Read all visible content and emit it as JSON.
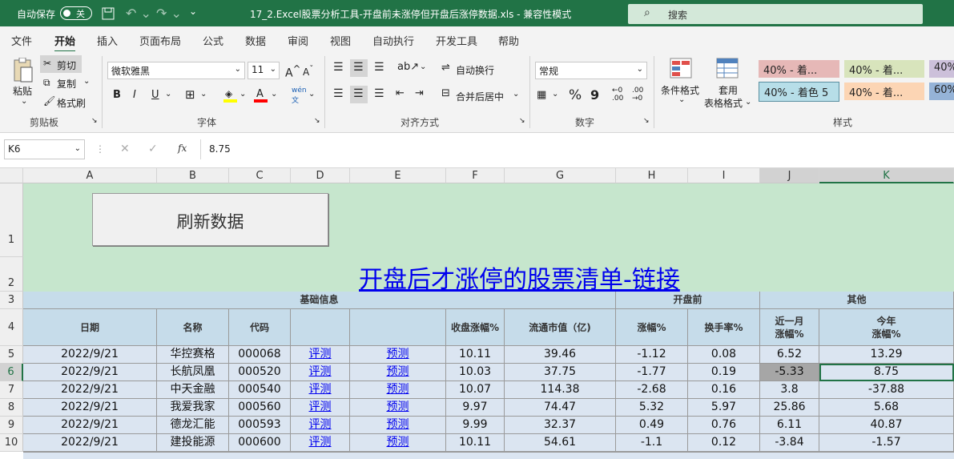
{
  "titlebar": {
    "autosave_label": "自动保存",
    "autosave_state": "关",
    "title": "17_2.Excel股票分析工具-开盘前未涨停但开盘后涨停数据.xls  -  兼容性模式",
    "search_placeholder": "搜索"
  },
  "tabs": [
    "文件",
    "开始",
    "插入",
    "页面布局",
    "公式",
    "数据",
    "审阅",
    "视图",
    "自动执行",
    "开发工具",
    "帮助"
  ],
  "ribbon": {
    "clipboard": {
      "paste": "粘贴",
      "cut": "剪切",
      "copy": "复制",
      "format_painter": "格式刷",
      "group": "剪贴板"
    },
    "font": {
      "name": "微软雅黑",
      "size": "11",
      "group": "字体",
      "bold": "B",
      "italic": "I",
      "underline": "U"
    },
    "align": {
      "wrap": "自动换行",
      "merge": "合并后居中",
      "group": "对齐方式"
    },
    "number": {
      "format": "常规",
      "group": "数字",
      "percent": "%",
      "comma": "9"
    },
    "styles": {
      "conditional": "条件格式",
      "table_format_1": "套用",
      "table_format_2": "表格格式",
      "group": "样式",
      "chips": [
        "40% - 着...",
        "40% - 着...",
        "40%",
        "40% - 着色 5",
        "40% - 着...",
        "60%"
      ]
    }
  },
  "formula_bar": {
    "name_box": "K6",
    "fx": "fx",
    "value": "8.75"
  },
  "columns": [
    "A",
    "B",
    "C",
    "D",
    "E",
    "F",
    "G",
    "H",
    "I",
    "J",
    "K"
  ],
  "rows": [
    "1",
    "2",
    "3",
    "4",
    "5",
    "6",
    "7",
    "8",
    "9",
    "10"
  ],
  "sheet": {
    "refresh_button": "刷新数据",
    "title_link": "开盘后才涨停的股票清单-链接",
    "group_headers": {
      "basic": "基础信息",
      "pre_open": "开盘前",
      "other": "其他"
    },
    "headers": [
      "日期",
      "名称",
      "代码",
      "",
      "",
      "收盘涨幅%",
      "流通市值（亿)",
      "涨幅%",
      "换手率%",
      "近一月\n涨幅%",
      "今年\n涨幅%"
    ],
    "data": [
      [
        "2022/9/21",
        "华控赛格",
        "000068",
        "评测",
        "预测",
        "10.11",
        "39.46",
        "-1.12",
        "0.08",
        "6.52",
        "13.29"
      ],
      [
        "2022/9/21",
        "长航凤凰",
        "000520",
        "评测",
        "预测",
        "10.03",
        "37.75",
        "-1.77",
        "0.19",
        "-5.33",
        "8.75"
      ],
      [
        "2022/9/21",
        "中天金融",
        "000540",
        "评测",
        "预测",
        "10.07",
        "114.38",
        "-2.68",
        "0.16",
        "3.8",
        "-37.88"
      ],
      [
        "2022/9/21",
        "我爱我家",
        "000560",
        "评测",
        "预测",
        "9.97",
        "74.47",
        "5.32",
        "5.97",
        "25.86",
        "5.68"
      ],
      [
        "2022/9/21",
        "德龙汇能",
        "000593",
        "评测",
        "预测",
        "9.99",
        "32.37",
        "0.49",
        "0.76",
        "6.11",
        "40.87"
      ],
      [
        "2022/9/21",
        "建投能源",
        "000600",
        "评测",
        "预测",
        "10.11",
        "54.61",
        "-1.1",
        "0.12",
        "-3.84",
        "-1.57"
      ]
    ]
  }
}
